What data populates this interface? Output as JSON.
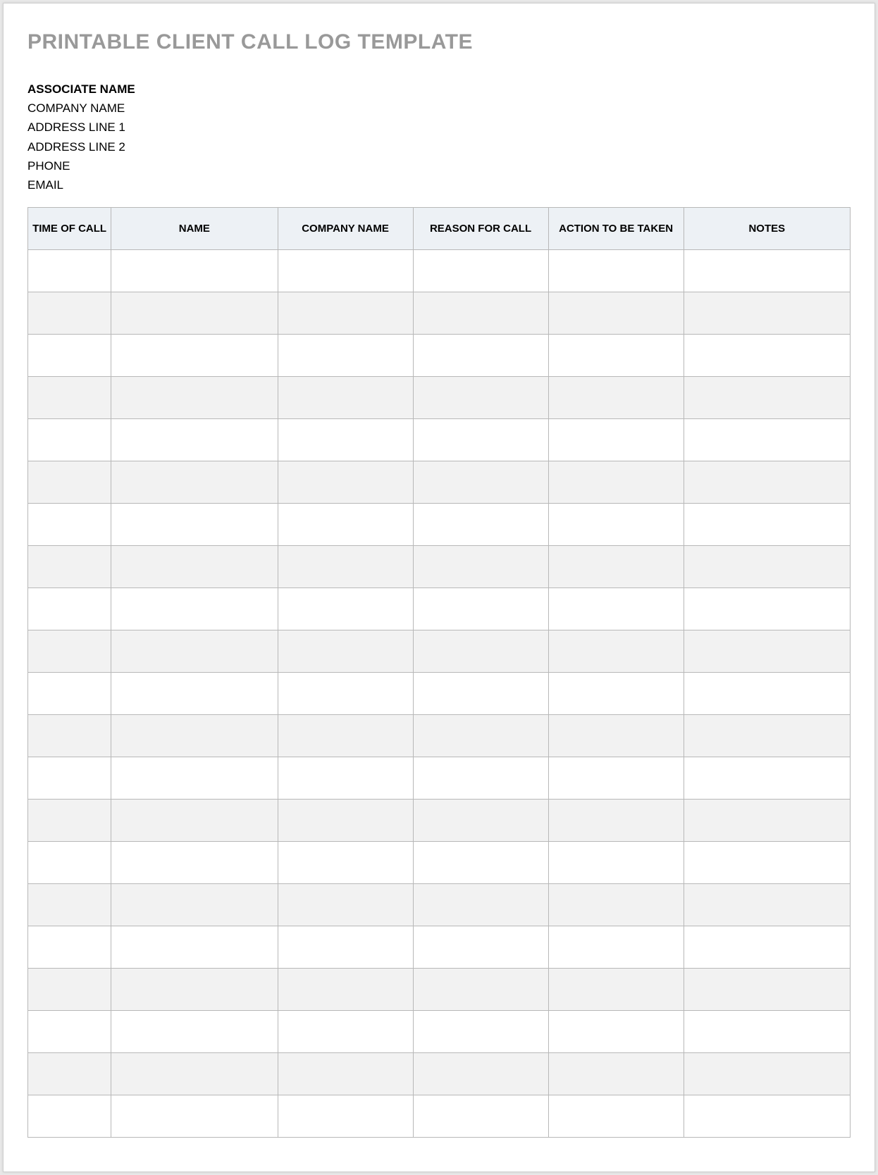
{
  "title": "PRINTABLE CLIENT CALL LOG TEMPLATE",
  "info": {
    "associate_name": "ASSOCIATE NAME",
    "company_name": "COMPANY NAME",
    "address_line_1": "ADDRESS LINE 1",
    "address_line_2": "ADDRESS LINE 2",
    "phone": "PHONE",
    "email": "EMAIL"
  },
  "columns": {
    "time_of_call": "TIME OF CALL",
    "name": "NAME",
    "company_name": "COMPANY NAME",
    "reason_for_call": "REASON FOR CALL",
    "action_to_be_taken": "ACTION TO BE TAKEN",
    "notes": "NOTES"
  },
  "rows": [
    {
      "time_of_call": "",
      "name": "",
      "company_name": "",
      "reason_for_call": "",
      "action_to_be_taken": "",
      "notes": ""
    },
    {
      "time_of_call": "",
      "name": "",
      "company_name": "",
      "reason_for_call": "",
      "action_to_be_taken": "",
      "notes": ""
    },
    {
      "time_of_call": "",
      "name": "",
      "company_name": "",
      "reason_for_call": "",
      "action_to_be_taken": "",
      "notes": ""
    },
    {
      "time_of_call": "",
      "name": "",
      "company_name": "",
      "reason_for_call": "",
      "action_to_be_taken": "",
      "notes": ""
    },
    {
      "time_of_call": "",
      "name": "",
      "company_name": "",
      "reason_for_call": "",
      "action_to_be_taken": "",
      "notes": ""
    },
    {
      "time_of_call": "",
      "name": "",
      "company_name": "",
      "reason_for_call": "",
      "action_to_be_taken": "",
      "notes": ""
    },
    {
      "time_of_call": "",
      "name": "",
      "company_name": "",
      "reason_for_call": "",
      "action_to_be_taken": "",
      "notes": ""
    },
    {
      "time_of_call": "",
      "name": "",
      "company_name": "",
      "reason_for_call": "",
      "action_to_be_taken": "",
      "notes": ""
    },
    {
      "time_of_call": "",
      "name": "",
      "company_name": "",
      "reason_for_call": "",
      "action_to_be_taken": "",
      "notes": ""
    },
    {
      "time_of_call": "",
      "name": "",
      "company_name": "",
      "reason_for_call": "",
      "action_to_be_taken": "",
      "notes": ""
    },
    {
      "time_of_call": "",
      "name": "",
      "company_name": "",
      "reason_for_call": "",
      "action_to_be_taken": "",
      "notes": ""
    },
    {
      "time_of_call": "",
      "name": "",
      "company_name": "",
      "reason_for_call": "",
      "action_to_be_taken": "",
      "notes": ""
    },
    {
      "time_of_call": "",
      "name": "",
      "company_name": "",
      "reason_for_call": "",
      "action_to_be_taken": "",
      "notes": ""
    },
    {
      "time_of_call": "",
      "name": "",
      "company_name": "",
      "reason_for_call": "",
      "action_to_be_taken": "",
      "notes": ""
    },
    {
      "time_of_call": "",
      "name": "",
      "company_name": "",
      "reason_for_call": "",
      "action_to_be_taken": "",
      "notes": ""
    },
    {
      "time_of_call": "",
      "name": "",
      "company_name": "",
      "reason_for_call": "",
      "action_to_be_taken": "",
      "notes": ""
    },
    {
      "time_of_call": "",
      "name": "",
      "company_name": "",
      "reason_for_call": "",
      "action_to_be_taken": "",
      "notes": ""
    },
    {
      "time_of_call": "",
      "name": "",
      "company_name": "",
      "reason_for_call": "",
      "action_to_be_taken": "",
      "notes": ""
    },
    {
      "time_of_call": "",
      "name": "",
      "company_name": "",
      "reason_for_call": "",
      "action_to_be_taken": "",
      "notes": ""
    },
    {
      "time_of_call": "",
      "name": "",
      "company_name": "",
      "reason_for_call": "",
      "action_to_be_taken": "",
      "notes": ""
    },
    {
      "time_of_call": "",
      "name": "",
      "company_name": "",
      "reason_for_call": "",
      "action_to_be_taken": "",
      "notes": ""
    }
  ]
}
